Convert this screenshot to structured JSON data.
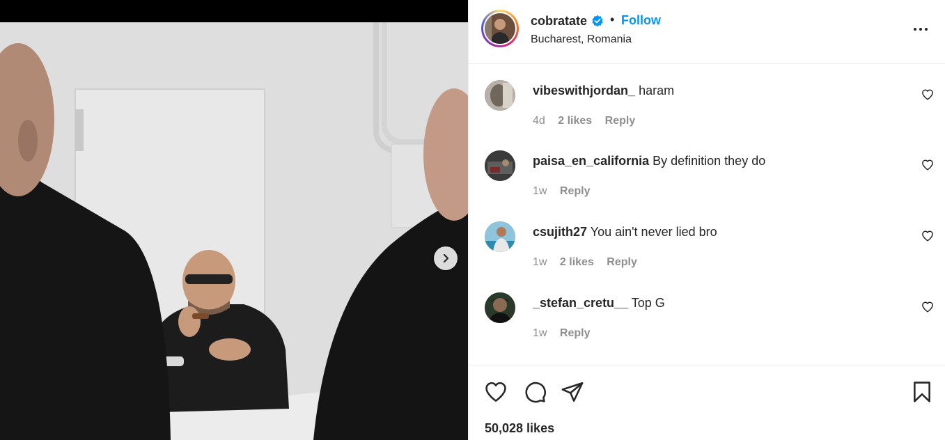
{
  "post": {
    "username": "cobratate",
    "separator": "•",
    "follow_label": "Follow",
    "location": "Bucharest, Romania",
    "likes_label": "50,028 likes"
  },
  "comments": [
    {
      "username": "vibeswithjordan_",
      "text": "haram",
      "time": "4d",
      "likes": "2 likes",
      "reply": "Reply"
    },
    {
      "username": "paisa_en_california",
      "text": "By definition they do",
      "time": "1w",
      "likes": "",
      "reply": "Reply"
    },
    {
      "username": "csujith27",
      "text": "You ain't never lied bro",
      "time": "1w",
      "likes": "2 likes",
      "reply": "Reply"
    },
    {
      "username": "_stefan_cretu__",
      "text": "Top G",
      "time": "1w",
      "likes": "",
      "reply": "Reply"
    }
  ],
  "colors": {
    "accent": "#0095f6",
    "text": "#262626",
    "secondary_text": "#8e8e8e",
    "divider": "#efefef"
  },
  "icons": {
    "next": "chevron-right-icon",
    "more": "more-horizontal-icon",
    "verified": "verified-badge-icon",
    "like": "heart-icon",
    "comment": "comment-bubble-icon",
    "share": "paper-plane-icon",
    "save": "bookmark-icon"
  }
}
